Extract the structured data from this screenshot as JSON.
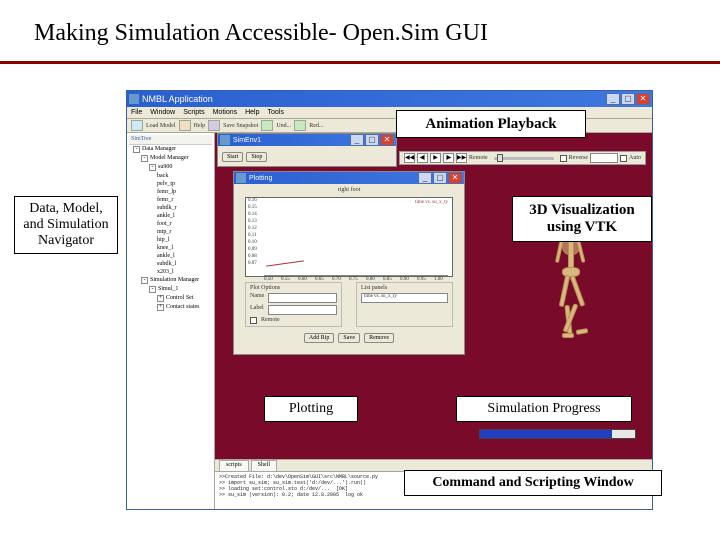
{
  "slide": {
    "title": "Making Simulation Accessible-  Open.Sim GUI"
  },
  "callouts": {
    "navigator": "Data, Model, and Simulation Navigator",
    "animation": "Animation Playback",
    "viz3d": "3D Visualization using VTK",
    "plotting": "Plotting",
    "progress": "Simulation Progress",
    "scripting": "Command and Scripting Window"
  },
  "app": {
    "title": "NMBL Application",
    "menus": [
      "File",
      "Window",
      "Scripts",
      "Motions",
      "Help",
      "Tools"
    ],
    "toolbar": {
      "loadModel": "Load Model",
      "help": "Help",
      "saveSnapshot": "Save Snapshot",
      "und": "Und...",
      "red": "Red..."
    }
  },
  "navigator": {
    "tab": "SimTree",
    "items": [
      {
        "d": 0,
        "ex": "-",
        "t": "Data Manager"
      },
      {
        "d": 1,
        "ex": "-",
        "t": "Model Manager"
      },
      {
        "d": 2,
        "ex": "-",
        "t": "su900"
      },
      {
        "d": 3,
        "t": "back"
      },
      {
        "d": 3,
        "t": "pelv_tp"
      },
      {
        "d": 3,
        "t": "femr_lp"
      },
      {
        "d": 3,
        "t": "femr_r"
      },
      {
        "d": 3,
        "t": "subtlk_r"
      },
      {
        "d": 3,
        "t": "ankle_l"
      },
      {
        "d": 3,
        "t": "foot_r"
      },
      {
        "d": 3,
        "t": "mtp_r"
      },
      {
        "d": 3,
        "t": "hip_l"
      },
      {
        "d": 3,
        "t": "knee_l"
      },
      {
        "d": 3,
        "t": "ankle_l"
      },
      {
        "d": 3,
        "t": "subtlk_l"
      },
      {
        "d": 3,
        "t": "x203_l"
      },
      {
        "d": 1,
        "ex": "-",
        "t": "Simulation Manager"
      },
      {
        "d": 2,
        "ex": "-",
        "t": "Simul_1"
      },
      {
        "d": 3,
        "ex": "+",
        "t": "Control Set"
      },
      {
        "d": 3,
        "ex": "+",
        "t": "Contact states"
      }
    ]
  },
  "simWindow": {
    "title": "SimEnv1",
    "start": "Start",
    "stop": "Stop"
  },
  "animToolbar": {
    "play": "▶",
    "rewind": "◀◀",
    "stepb": "◀|",
    "stepf": "|▶",
    "ff": "▶▶",
    "remote": "Remote",
    "reverse": "Reverse",
    "auto": "Auto"
  },
  "plot": {
    "title": "Plotting",
    "chartTitle": "right foot",
    "legend": "time vs. su_x_ty",
    "plotOptions": {
      "title": "Plot Options",
      "name": "Name",
      "label": "Label",
      "remote": "Remote"
    },
    "listPanel": {
      "title": "List panels",
      "item": "time vs. su_x_ty"
    },
    "addRip": "Add Rip",
    "save": "Save",
    "remove": "Remove"
  },
  "chart_data": {
    "type": "line",
    "title": "right foot",
    "series": [
      {
        "name": "time vs. su_x_ty",
        "values": [
          0.1,
          0.08
        ]
      }
    ],
    "x": [
      0.5,
      0.55,
      0.6,
      0.65,
      0.7,
      0.75,
      0.8,
      0.85,
      0.9,
      0.95,
      1.0
    ],
    "ylim": [
      0.07,
      0.16
    ],
    "yticks": [
      0.16,
      0.15,
      0.14,
      0.13,
      0.12,
      0.11,
      0.1,
      0.09,
      0.08,
      0.07
    ],
    "xlabel": "",
    "ylabel": ""
  },
  "bottomTabs": [
    "scripts",
    "Shell"
  ],
  "console": {
    "lines": [
      ">>Created File: d:\\dev\\OpenSim\\GUI\\src\\NMBL\\source.py",
      ">> import su_sim; su_sim.test('d:/dev/...').run()",
      ">> loading set:control.sto d:/dev/...  [OK]",
      ">> su_sim (version): 0.2; date 12.8.2005  log ok"
    ]
  },
  "windowBtns": {
    "min": "_",
    "max": "▢",
    "close": "✕"
  }
}
